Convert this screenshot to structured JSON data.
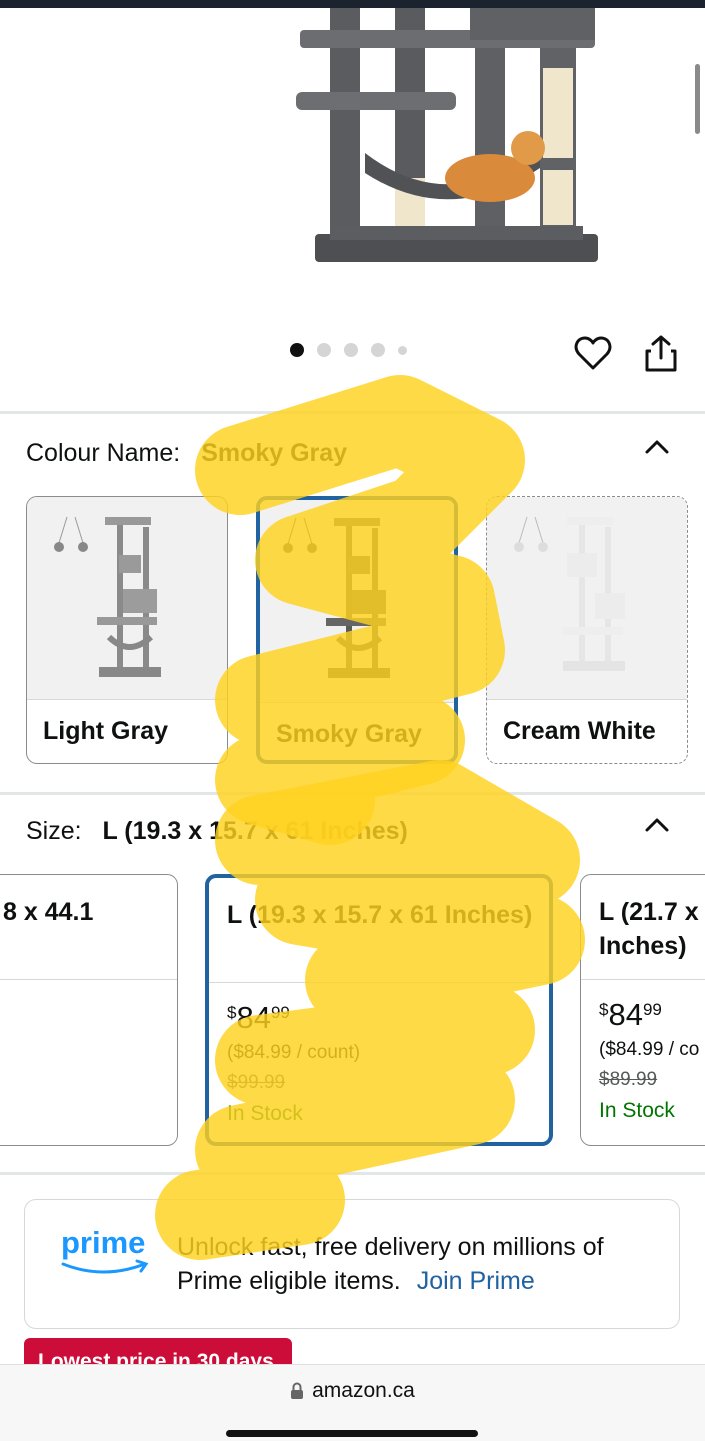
{
  "colour": {
    "label": "Colour Name:",
    "selected": "Smoky Gray",
    "options": [
      {
        "label": "Light Gray",
        "state": "normal"
      },
      {
        "label": "Smoky Gray",
        "state": "selected"
      },
      {
        "label": "Cream White",
        "state": "unavailable"
      }
    ]
  },
  "size": {
    "label": "Size:",
    "selected": "L (19.3 x 15.7 x 61 Inches)",
    "options": [
      {
        "title": "8 x 44.1",
        "price_currency": "",
        "price_whole": "",
        "price_fraction": "",
        "unit_price": "",
        "list_price": "",
        "stock": ""
      },
      {
        "title": "L (19.3 x 15.7 x 61 Inches)",
        "price_currency": "$",
        "price_whole": "84",
        "price_fraction": "99",
        "unit_price": "($84.99 / count)",
        "list_price": "$99.99",
        "stock": "In Stock"
      },
      {
        "title_line1": "L (21.7 x",
        "title_line2": "Inches)",
        "price_currency": "$",
        "price_whole": "84",
        "price_fraction": "99",
        "unit_price": "($84.99 / co",
        "list_price": "$89.99",
        "stock": "In Stock"
      }
    ]
  },
  "prime": {
    "logo_text": "prime",
    "message": "Unlock fast, free delivery on millions of Prime eligible items.",
    "link": "Join Prime"
  },
  "badge": "Lowest price in 30 days",
  "browser": {
    "url": "amazon.ca"
  },
  "carousel": {
    "total_dots": 5,
    "active_index": 0
  },
  "colors": {
    "selected_border": "#2162a1",
    "stock_green": "#007600",
    "link_blue": "#2162a1",
    "badge_red": "#cc0c39",
    "highlight": "#ffd21f"
  }
}
